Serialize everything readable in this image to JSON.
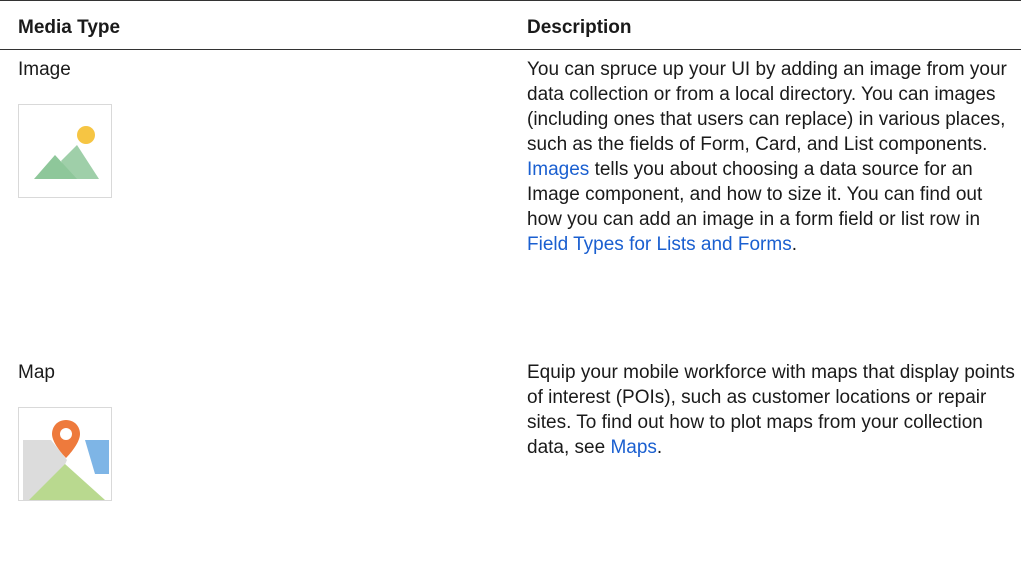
{
  "table": {
    "headers": {
      "media_type": "Media Type",
      "description": "Description"
    },
    "rows": [
      {
        "media_type": "Image",
        "thumbnail_icon": "image-placeholder-icon",
        "description": {
          "p1": "You can spruce up your UI by adding an image from your data collection or from a local directory. You can images (including ones that users can replace) in various places, such as the fields of Form, Card, and List components. ",
          "link1": "Images",
          "p2": " tells you about choosing a data source for an Image component, and how to size it. You can find out how you can add an image in a form field or list row in ",
          "link2": "Field Types for Lists and Forms",
          "p3": "."
        }
      },
      {
        "media_type": "Map",
        "thumbnail_icon": "map-pin-icon",
        "description": {
          "p1": "Equip your mobile workforce with maps that display points of interest (POIs), such as customer locations or repair sites. To find out how to plot maps from your collection data, see ",
          "link1": "Maps",
          "p2": "."
        }
      }
    ]
  },
  "colors": {
    "link": "#1a5fd0",
    "rule": "#333333",
    "thumb_border": "#d9d9d9",
    "sun": "#f6c543",
    "mountain": "#8ec79a",
    "pin": "#ee7a3c",
    "map_blue": "#7eb5e6",
    "map_grey": "#dcdcdc",
    "map_green": "#b9d98f"
  }
}
